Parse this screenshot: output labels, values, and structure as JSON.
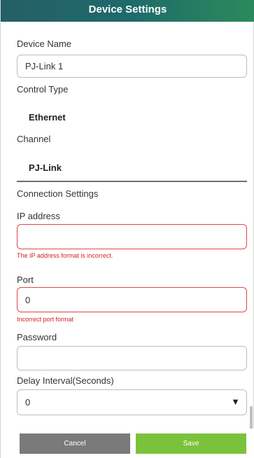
{
  "header": {
    "title": "Device Settings"
  },
  "device_name": {
    "label": "Device Name",
    "value": "PJ-Link 1"
  },
  "control_type": {
    "label": "Control Type",
    "value": "Ethernet"
  },
  "channel": {
    "label": "Channel",
    "value": "PJ-Link"
  },
  "connection_settings": {
    "label": "Connection Settings"
  },
  "ip_address": {
    "label": "IP address",
    "value": "",
    "error": "The IP address format is incorrect."
  },
  "port": {
    "label": "Port",
    "value": "0",
    "error": "Incorrect port format"
  },
  "password": {
    "label": "Password",
    "value": ""
  },
  "delay_interval": {
    "label": "Delay Interval(Seconds)",
    "value": "0"
  },
  "footer": {
    "cancel_label": "Cancel",
    "save_label": "Save"
  },
  "colors": {
    "header_start": "#245f66",
    "header_end": "#2b8a5c",
    "error": "#d21f26",
    "cancel": "#7a7a7a",
    "save": "#7bc23b"
  },
  "icons": {
    "dropdown": "caret-down-icon"
  }
}
